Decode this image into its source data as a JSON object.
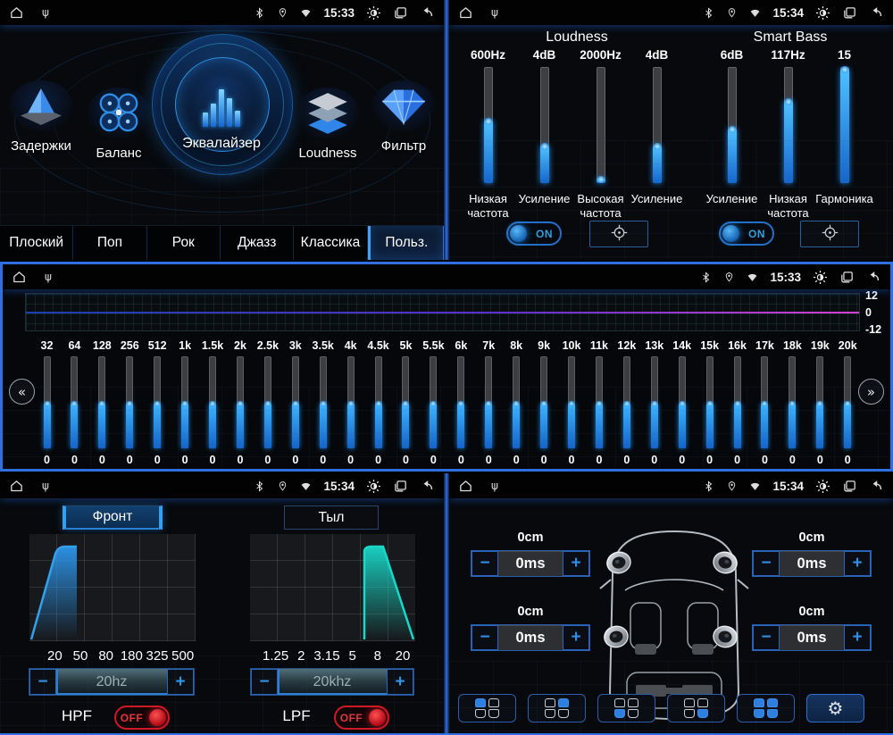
{
  "icons": {
    "usb": "ψ",
    "gear": "⚙",
    "chevron_left": "«",
    "chevron_right": "»",
    "minus": "−",
    "plus": "+"
  },
  "colors": {
    "accent_blue": "#2f6fe0",
    "slider_fill": "#2196f3",
    "off_red": "#d01828",
    "eq_line_left": "#1b3fae",
    "eq_line_right": "#d63fd0"
  },
  "panels": {
    "eq_menu": {
      "time": "15:33",
      "menu": [
        {
          "label": "Задержки"
        },
        {
          "label": "Баланс"
        },
        {
          "label": "Эквалайзер"
        },
        {
          "label": "Loudness"
        },
        {
          "label": "Фильтр"
        }
      ],
      "presets": [
        {
          "label": "Плоский",
          "state": ""
        },
        {
          "label": "Поп",
          "state": ""
        },
        {
          "label": "Рок",
          "state": ""
        },
        {
          "label": "Джазз",
          "state": ""
        },
        {
          "label": "Классика",
          "state": ""
        },
        {
          "label": "Польз.",
          "state": "selected"
        }
      ]
    },
    "loudness": {
      "time": "15:34",
      "section_titles": [
        "Loudness",
        "Smart Bass"
      ],
      "sliders": [
        {
          "value": "600Hz",
          "caption": "Низкая частота",
          "fill_pct": 55
        },
        {
          "value": "4dB",
          "caption": "Усиление",
          "fill_pct": 33
        },
        {
          "value": "2000Hz",
          "caption": "Высокая частота",
          "fill_pct": 4
        },
        {
          "value": "4dB",
          "caption": "Усиление",
          "fill_pct": 33
        },
        {
          "value": "6dB",
          "caption": "Усиление",
          "fill_pct": 48
        },
        {
          "value": "117Hz",
          "caption": "Низкая частота",
          "fill_pct": 72
        },
        {
          "value": "15",
          "caption": "Гармоника",
          "fill_pct": 100
        }
      ],
      "loudness_toggle": "ON",
      "smartbass_toggle": "ON"
    },
    "band_eq": {
      "time": "15:33",
      "scale": {
        "top": "12",
        "mid": "0",
        "bottom": "-12"
      },
      "fill_pct": 50,
      "bands": [
        {
          "f": "32",
          "v": "0"
        },
        {
          "f": "64",
          "v": "0"
        },
        {
          "f": "128",
          "v": "0"
        },
        {
          "f": "256",
          "v": "0"
        },
        {
          "f": "512",
          "v": "0"
        },
        {
          "f": "1k",
          "v": "0"
        },
        {
          "f": "1.5k",
          "v": "0"
        },
        {
          "f": "2k",
          "v": "0"
        },
        {
          "f": "2.5k",
          "v": "0"
        },
        {
          "f": "3k",
          "v": "0"
        },
        {
          "f": "3.5k",
          "v": "0"
        },
        {
          "f": "4k",
          "v": "0"
        },
        {
          "f": "4.5k",
          "v": "0"
        },
        {
          "f": "5k",
          "v": "0"
        },
        {
          "f": "5.5k",
          "v": "0"
        },
        {
          "f": "6k",
          "v": "0"
        },
        {
          "f": "7k",
          "v": "0"
        },
        {
          "f": "8k",
          "v": "0"
        },
        {
          "f": "9k",
          "v": "0"
        },
        {
          "f": "10k",
          "v": "0"
        },
        {
          "f": "11k",
          "v": "0"
        },
        {
          "f": "12k",
          "v": "0"
        },
        {
          "f": "13k",
          "v": "0"
        },
        {
          "f": "14k",
          "v": "0"
        },
        {
          "f": "15k",
          "v": "0"
        },
        {
          "f": "16k",
          "v": "0"
        },
        {
          "f": "17k",
          "v": "0"
        },
        {
          "f": "18k",
          "v": "0"
        },
        {
          "f": "19k",
          "v": "0"
        },
        {
          "f": "20k",
          "v": "0"
        }
      ]
    },
    "filter": {
      "time": "15:34",
      "tabs": [
        {
          "label": "Фронт",
          "slot": "tab-front",
          "state": "selected"
        },
        {
          "label": "Тыл",
          "slot": "tab-rear",
          "state": ""
        }
      ],
      "hpf": {
        "name": "HPF",
        "state": "OFF",
        "value": "20hz",
        "x_labels": [
          "20",
          "50",
          "80",
          "180",
          "325",
          "500"
        ]
      },
      "lpf": {
        "name": "LPF",
        "state": "OFF",
        "value": "20khz",
        "x_labels": [
          "1.25",
          "2",
          "3.15",
          "5",
          "8",
          "20"
        ]
      }
    },
    "delay": {
      "time": "15:34",
      "corners": [
        {
          "slot": "fl",
          "distance": "0cm",
          "delay": "0ms"
        },
        {
          "slot": "fr",
          "distance": "0cm",
          "delay": "0ms"
        },
        {
          "slot": "rl",
          "distance": "0cm",
          "delay": "0ms"
        },
        {
          "slot": "rr",
          "distance": "0cm",
          "delay": "0ms"
        }
      ],
      "seat_buttons": [
        {
          "name": "front-left-seat",
          "icon": "seats-fl",
          "state": ""
        },
        {
          "name": "front-right-seat",
          "icon": "seats-fr",
          "state": ""
        },
        {
          "name": "rear-left-seat",
          "icon": "seats-rl",
          "state": ""
        },
        {
          "name": "rear-right-seat",
          "icon": "seats-rr",
          "state": ""
        },
        {
          "name": "all-seats",
          "icon": "seats-all",
          "state": ""
        },
        {
          "name": "settings",
          "icon": "gear",
          "state": "selected"
        }
      ]
    }
  }
}
